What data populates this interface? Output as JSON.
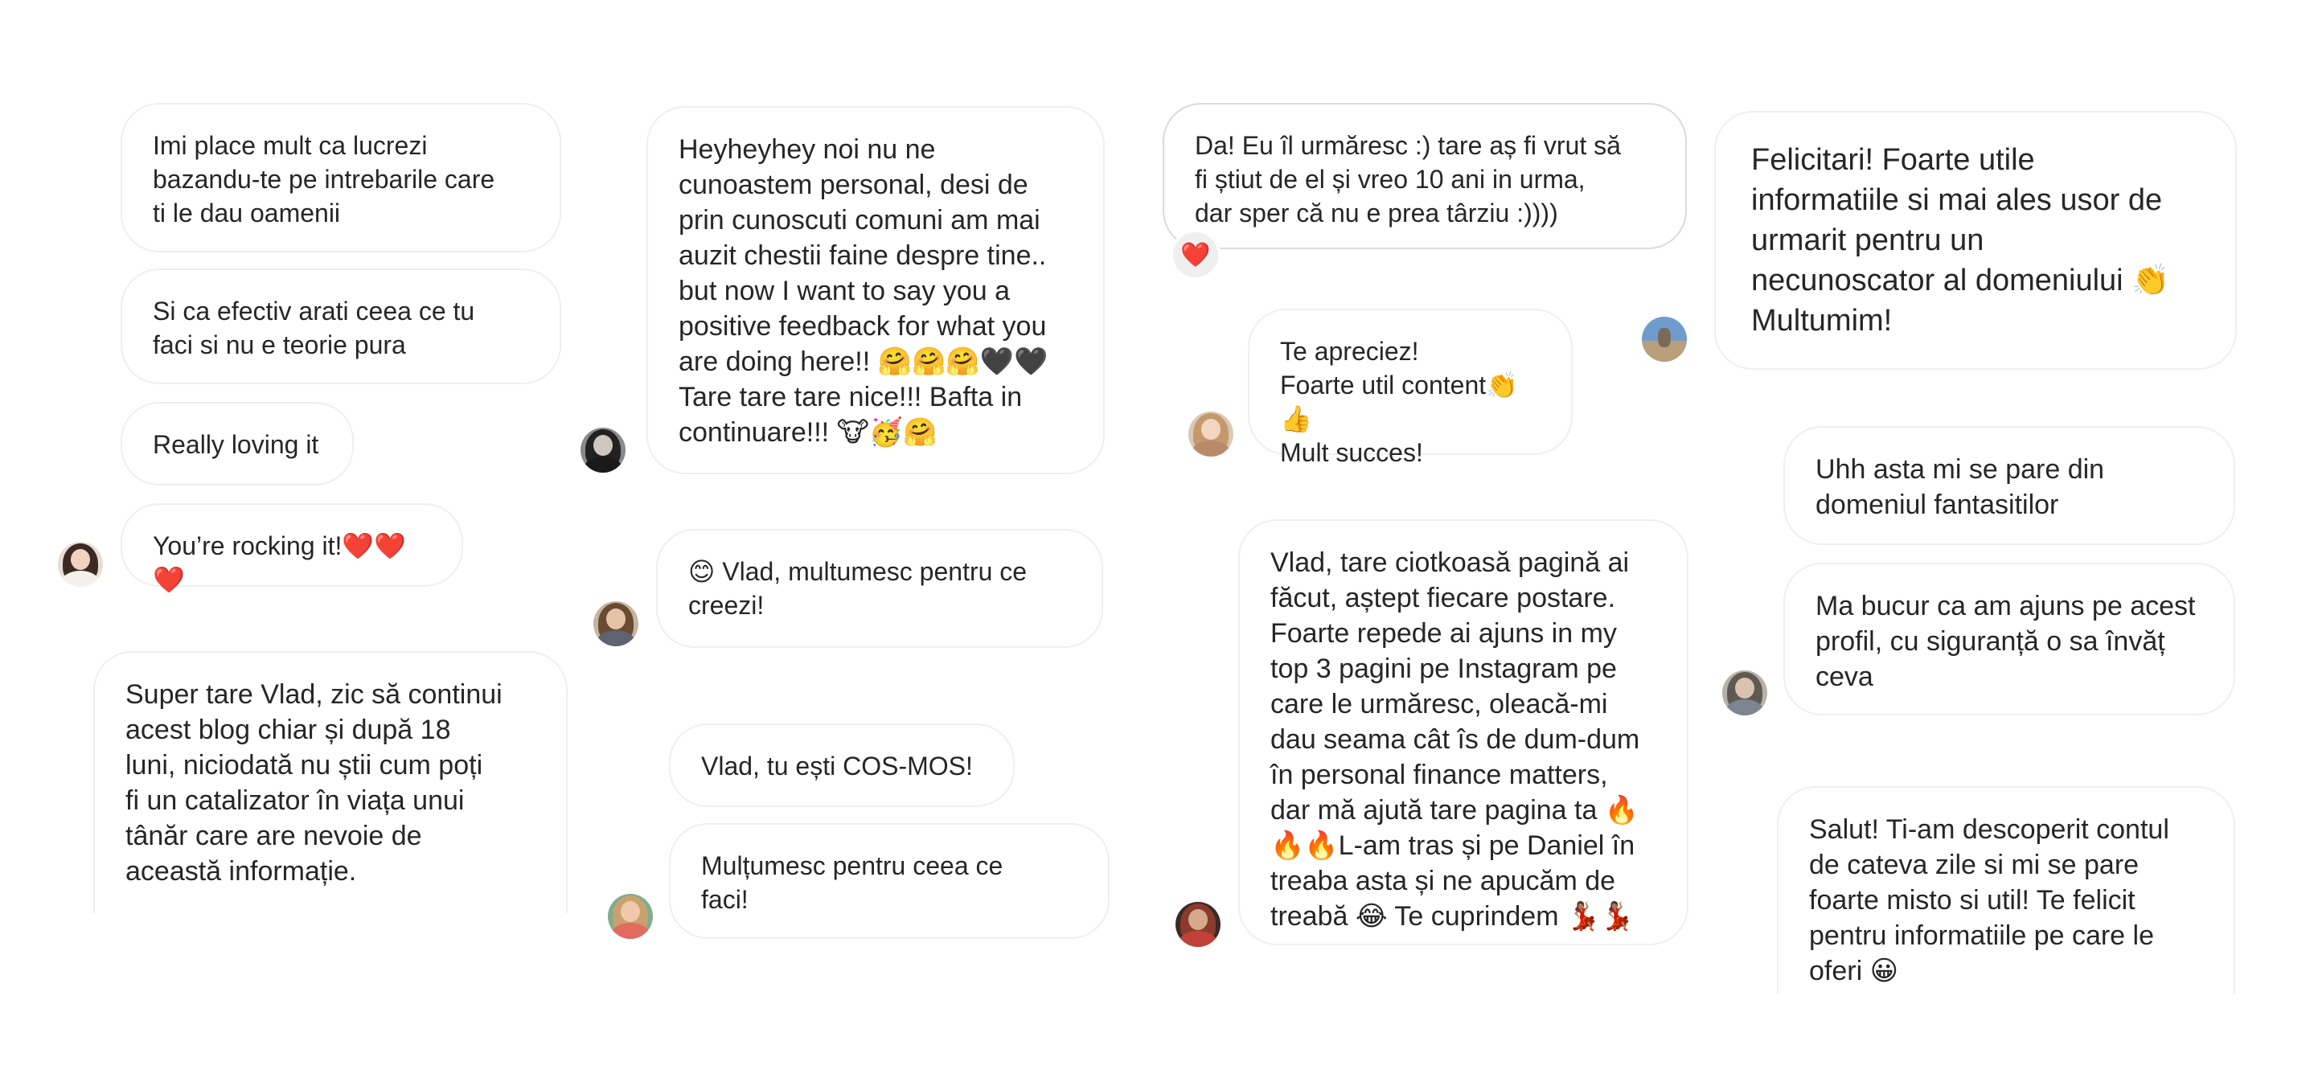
{
  "messages": [
    {
      "text": "Imi place mult ca lucrezi\nbazandu-te pe intrebarile care\nti le dau oamenii"
    },
    {
      "text": "Si ca efectiv arati ceea ce tu\nfaci si nu e teorie pura"
    },
    {
      "text": "Really loving it"
    },
    {
      "text": "You’re rocking it!❤️❤️❤️"
    },
    {
      "text": "Super tare Vlad, zic să continui\nacest blog chiar și după 18\nluni, niciodată nu știi cum poți\nfi un catalizator în viața unui\ntânăr care are nevoie de\naceastă informație."
    },
    {
      "text": "Heyheyhey noi nu ne\ncunoastem personal, desi de\nprin cunoscuti comuni am mai\nauzit chestii faine despre tine..\nbut now I want to say you a\npositive feedback for what you\nare doing here!! 🤗🤗🤗🖤🖤\nTare tare tare nice!!! Bafta in\ncontinuare!!! 🐮🥳🤗"
    },
    {
      "text": "😊 Vlad, multumesc pentru ce\ncreezi!"
    },
    {
      "text": "Vlad, tu ești COS-MOS!"
    },
    {
      "text": "Mulțumesc pentru ceea ce\nfaci!"
    },
    {
      "text": "Da! Eu îl urmăresc :) tare aș fi vrut să\nfi știut de el și vreo 10 ani in urma,\ndar sper că nu e prea târziu :))))",
      "reaction": "❤️"
    },
    {
      "text": "Te apreciez!\nFoarte util content👏👍\nMult succes!"
    },
    {
      "text": "Vlad, tare ciotkoasă pagină ai\nfăcut, aștept fiecare postare.\nFoarte repede ai ajuns in my\ntop 3 pagini pe Instagram pe\ncare le urmăresc, oleacă-mi\ndau seama cât îs de dum-dum\nîn personal finance matters,\ndar mă ajută tare pagina ta 🔥\n🔥🔥L-am tras și pe Daniel în\ntreaba asta și ne apucăm de\ntreabă 😂 Te cuprindem 💃🏽💃🏽"
    },
    {
      "text": "Felicitari! Foarte utile\ninformatiile si mai ales usor de\nurmarit pentru un\nnecunoscator al domeniului 👏\nMultumim!"
    },
    {
      "text": "Uhh asta mi se pare din\ndomeniul fantasitilor"
    },
    {
      "text": "Ma bucur ca am ajuns pe acest\nprofil, cu siguranță o sa învăț\nceva"
    },
    {
      "text": "Salut! Ti-am descoperit contul\nde cateva zile si mi se pare\nfoarte misto si util! Te felicit\npentru informatiile pe care le\noferi 😀"
    }
  ],
  "colors": {
    "bubble_border": "#efefef",
    "text": "#262626",
    "reaction_bg": "#efefef",
    "heart": "#ed4956"
  }
}
